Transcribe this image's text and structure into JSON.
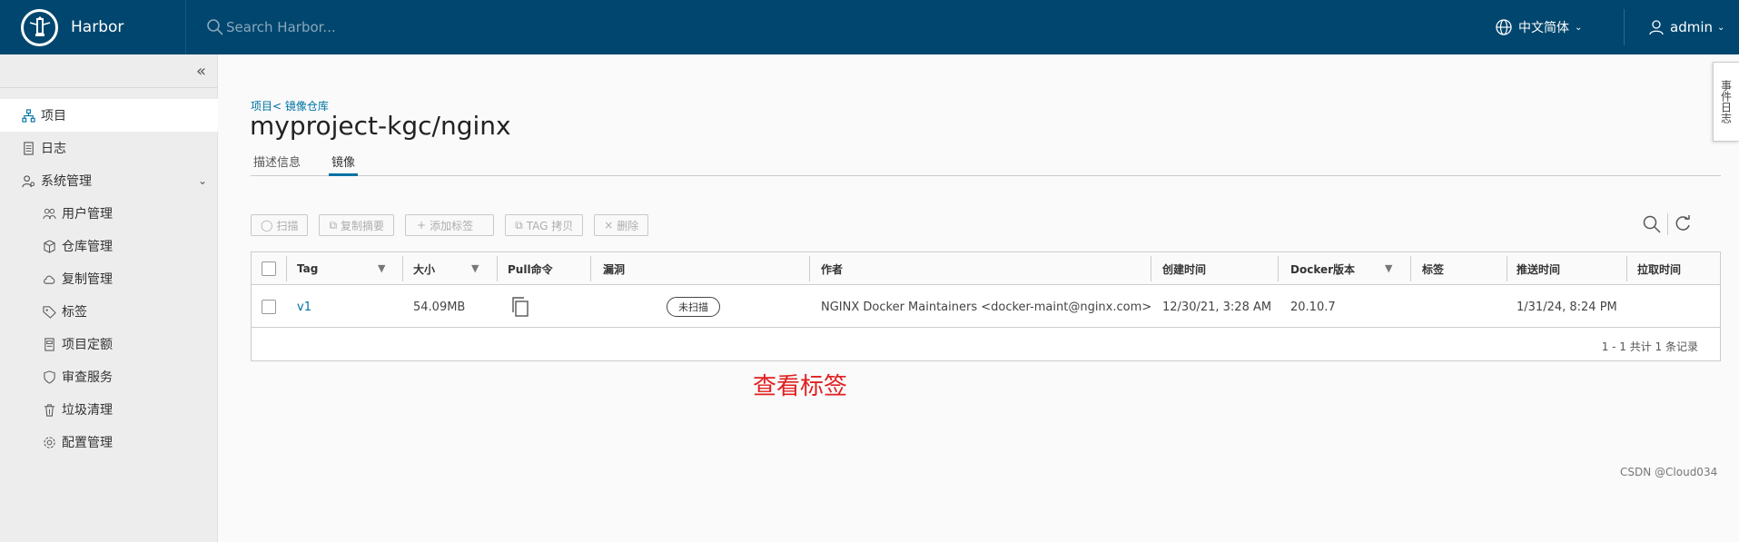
{
  "header": {
    "brand": "Harbor",
    "search_placeholder": "Search Harbor...",
    "language": "中文简体",
    "user": "admin"
  },
  "sidebar": {
    "items": [
      {
        "label": "项目",
        "active": true
      },
      {
        "label": "日志"
      },
      {
        "label": "系统管理",
        "expanded": true
      },
      {
        "label": "用户管理"
      },
      {
        "label": "仓库管理"
      },
      {
        "label": "复制管理"
      },
      {
        "label": "标签"
      },
      {
        "label": "项目定额"
      },
      {
        "label": "审查服务"
      },
      {
        "label": "垃圾清理"
      },
      {
        "label": "配置管理"
      }
    ]
  },
  "main": {
    "breadcrumb": "项目< 镜像仓库",
    "title": "myproject-kgc/nginx",
    "tabs": [
      {
        "label": "描述信息"
      },
      {
        "label": "镜像",
        "active": true
      }
    ],
    "toolbar": {
      "scan": "扫描",
      "copy_digest": "复制摘要",
      "add_label": "添加标签",
      "tag_copy": "TAG 拷贝",
      "delete": "删除"
    },
    "table": {
      "columns": [
        "Tag",
        "大小",
        "Pull命令",
        "漏洞",
        "作者",
        "创建时间",
        "Docker版本",
        "标签",
        "推送时间",
        "拉取时间"
      ],
      "rows": [
        {
          "tag": "v1",
          "size": "54.09MB",
          "vulnerability": "未扫描",
          "author": "NGINX Docker Maintainers <docker-maint@nginx.com>",
          "created": "12/30/21, 3:28 AM",
          "docker_version": "20.10.7",
          "labels": "",
          "push_time": "1/31/24, 8:24 PM",
          "pull_time": ""
        }
      ],
      "footer": "1 - 1 共计 1 条记录"
    }
  },
  "annotation": "查看标签",
  "side_tab": "事件日志",
  "watermark": "CSDN @Cloud034"
}
